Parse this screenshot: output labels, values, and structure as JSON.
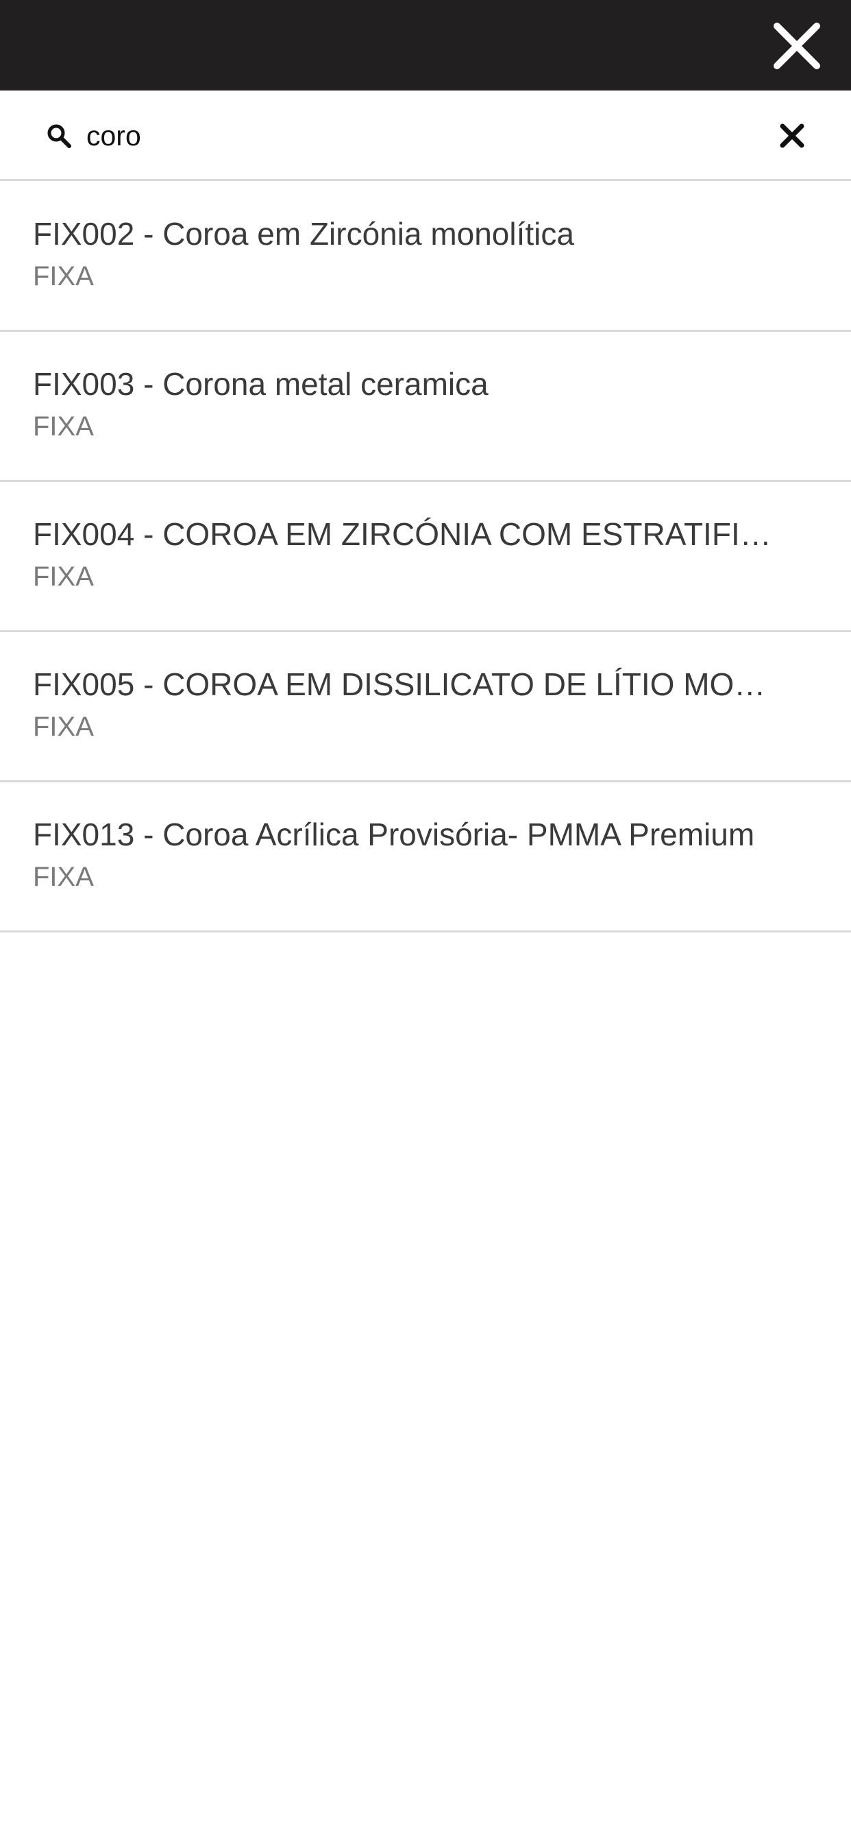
{
  "header": {
    "close_icon": "close-icon"
  },
  "search": {
    "value": "coro",
    "search_icon": "search-icon",
    "clear_icon": "clear-icon"
  },
  "results": [
    {
      "title": "FIX002 - Coroa em Zircónia monolítica",
      "category": "FIXA"
    },
    {
      "title": "FIX003 - Corona metal ceramica",
      "category": "FIXA"
    },
    {
      "title": "FIX004 - COROA EM ZIRCÓNIA COM ESTRATIFI…",
      "category": "FIXA"
    },
    {
      "title": "FIX005 - COROA EM DISSILICATO DE LÍTIO MO…",
      "category": "FIXA"
    },
    {
      "title": "FIX013 - Coroa Acrílica Provisória- PMMA Premium",
      "category": "FIXA"
    }
  ],
  "colors": {
    "header_bg": "#221f20",
    "title_text": "#3a3a3a",
    "subtitle_text": "#7a7a7a",
    "divider": "#d9d9d9"
  }
}
